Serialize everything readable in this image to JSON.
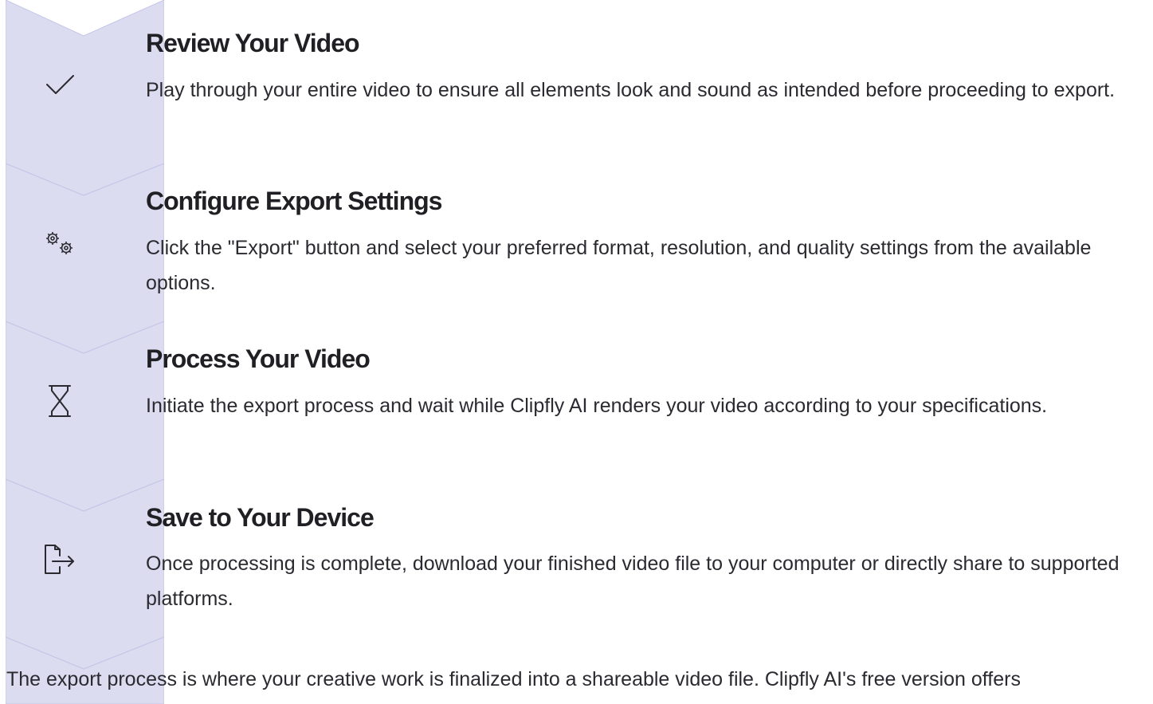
{
  "steps": [
    {
      "title": "Review Your Video",
      "description": "Play through your entire video to ensure all elements look and sound as intended before proceeding to export.",
      "icon": "checkmark-icon"
    },
    {
      "title": "Configure Export Settings",
      "description": "Click the \"Export\" button and select your preferred format, resolution, and quality settings from the available options.",
      "icon": "gears-icon"
    },
    {
      "title": "Process Your Video",
      "description": "Initiate the export process and wait while Clipfly AI renders your video according to your specifications.",
      "icon": "hourglass-icon"
    },
    {
      "title": "Save to Your Device",
      "description": "Once processing is complete, download your finished video file to your computer or directly share to supported platforms.",
      "icon": "export-file-icon"
    }
  ],
  "footer": {
    "text": "The export process is where your creative work is finalized into a shareable video file. Clipfly AI's free version offers"
  },
  "colors": {
    "chevron_fill": "#dcdcf1",
    "chevron_stroke": "#c4c4e6",
    "text": "#1f1f24",
    "icon": "#2a2a30"
  }
}
